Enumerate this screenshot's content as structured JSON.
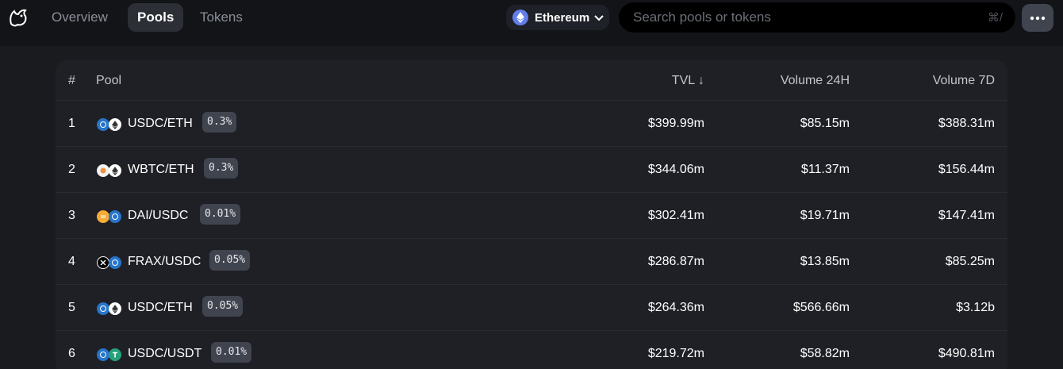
{
  "nav": {
    "tabs": [
      {
        "label": "Overview",
        "active": false
      },
      {
        "label": "Pools",
        "active": true
      },
      {
        "label": "Tokens",
        "active": false
      }
    ]
  },
  "network": {
    "label": "Ethereum",
    "icon": "ethereum-icon"
  },
  "search": {
    "placeholder": "Search pools or tokens",
    "shortcut": "⌘/"
  },
  "table": {
    "columns": {
      "rank": "#",
      "pool": "Pool",
      "tvl": "TVL ↓",
      "volume24h": "Volume 24H",
      "volume7d": "Volume 7D"
    },
    "rows": [
      {
        "rank": "1",
        "pair": "USDC/ETH",
        "fee": "0.3%",
        "tvl": "$399.99m",
        "volume24h": "$85.15m",
        "volume7d": "$388.31m",
        "tokens": [
          "usdc",
          "eth"
        ]
      },
      {
        "rank": "2",
        "pair": "WBTC/ETH",
        "fee": "0.3%",
        "tvl": "$344.06m",
        "volume24h": "$11.37m",
        "volume7d": "$156.44m",
        "tokens": [
          "wbtc",
          "eth"
        ]
      },
      {
        "rank": "3",
        "pair": "DAI/USDC",
        "fee": "0.01%",
        "tvl": "$302.41m",
        "volume24h": "$19.71m",
        "volume7d": "$147.41m",
        "tokens": [
          "dai",
          "usdc"
        ]
      },
      {
        "rank": "4",
        "pair": "FRAX/USDC",
        "fee": "0.05%",
        "tvl": "$286.87m",
        "volume24h": "$13.85m",
        "volume7d": "$85.25m",
        "tokens": [
          "frax",
          "usdc"
        ]
      },
      {
        "rank": "5",
        "pair": "USDC/ETH",
        "fee": "0.05%",
        "tvl": "$264.36m",
        "volume24h": "$566.66m",
        "volume7d": "$3.12b",
        "tokens": [
          "usdc",
          "eth"
        ]
      },
      {
        "rank": "6",
        "pair": "USDC/USDT",
        "fee": "0.01%",
        "tvl": "$219.72m",
        "volume24h": "$58.82m",
        "volume7d": "$490.81m",
        "tokens": [
          "usdc",
          "usdt"
        ]
      }
    ]
  },
  "colors": {
    "background": "#191b1f",
    "topbar": "#131417",
    "card": "#1f2026",
    "active_tab": "#2c2f36",
    "badge": "#40444f",
    "usdc": "#2775ca",
    "eth": "#ffffff",
    "wbtc": "#f2f2f2",
    "dai": "#f5ac37",
    "frax": "#000000",
    "usdt": "#26a17b",
    "ethereum": "#627eea"
  }
}
